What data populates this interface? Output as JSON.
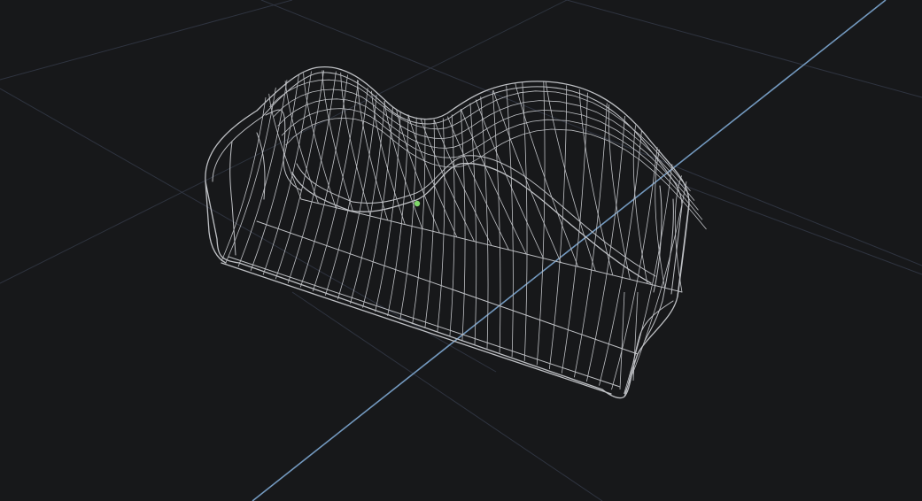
{
  "viewport": {
    "background_color": "#17181a",
    "grid_color": "#2f3440",
    "axis_color": "#7399bf",
    "wireframe_color": "#bfc1c5",
    "pivot_color": "#7fd66a"
  },
  "scene": {
    "object": "wireframe-mesh",
    "shading": "wireframe",
    "grid": true,
    "axis_visible": true
  }
}
